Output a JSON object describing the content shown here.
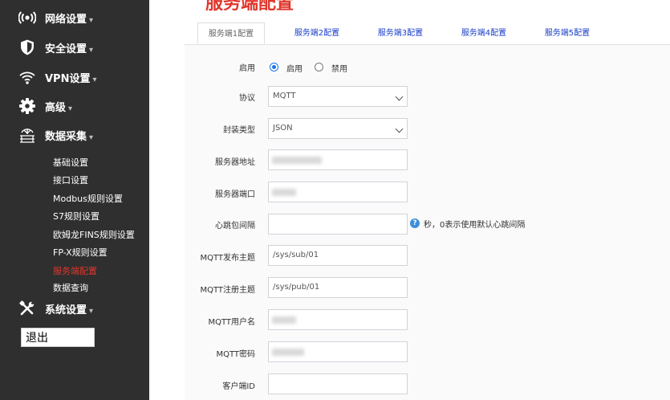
{
  "sidebar": {
    "items": [
      {
        "label": "网络设置",
        "icon": "signal-broadcast-icon"
      },
      {
        "label": "安全设置",
        "icon": "shield-icon"
      },
      {
        "label": "VPN设置",
        "icon": "wifi-icon"
      },
      {
        "label": "高级",
        "icon": "gear-icon"
      },
      {
        "label": "数据采集",
        "icon": "data-collection-icon"
      },
      {
        "label": "系统设置",
        "icon": "tools-icon"
      }
    ],
    "caret": "▾",
    "data_submenu": [
      "基础设置",
      "接口设置",
      "Modbus规则设置",
      "S7规则设置",
      "欧姆龙FINS规则设置",
      "FP-X规则设置",
      "服务端配置",
      "数据查询"
    ],
    "active_submenu": "服务端配置",
    "logout_label": "退出"
  },
  "main": {
    "title": "服务端配置",
    "tabs": [
      "服务端1配置",
      "服务端2配置",
      "服务端3配置",
      "服务端4配置",
      "服务端5配置"
    ],
    "active_tab": 0
  },
  "form": {
    "enable_label": "启用",
    "enable_on": "启用",
    "enable_off": "禁用",
    "enabled": true,
    "protocol_label": "协议",
    "protocol_value": "MQTT",
    "encap_label": "封装类型",
    "encap_value": "JSON",
    "server_addr_label": "服务器地址",
    "server_port_label": "服务器端口",
    "heartbeat_label": "心跳包间隔",
    "heartbeat_value": "",
    "heartbeat_hint": "秒，0表示使用默认心跳间隔",
    "help_glyph": "?",
    "pub_topic_label": "MQTT发布主题",
    "pub_topic_value": "/sys/sub/01",
    "reg_topic_label": "MQTT注册主题",
    "reg_topic_value": "/sys/pub/01",
    "username_label": "MQTT用户名",
    "password_label": "MQTT密码",
    "client_id_label": "客户端ID",
    "client_id_value": ""
  },
  "colors": {
    "sidebar_bg": "#2f2f2f",
    "accent_red": "#e0362c",
    "tab_link": "#1a3ec9",
    "radio_blue": "#1a73e8"
  }
}
